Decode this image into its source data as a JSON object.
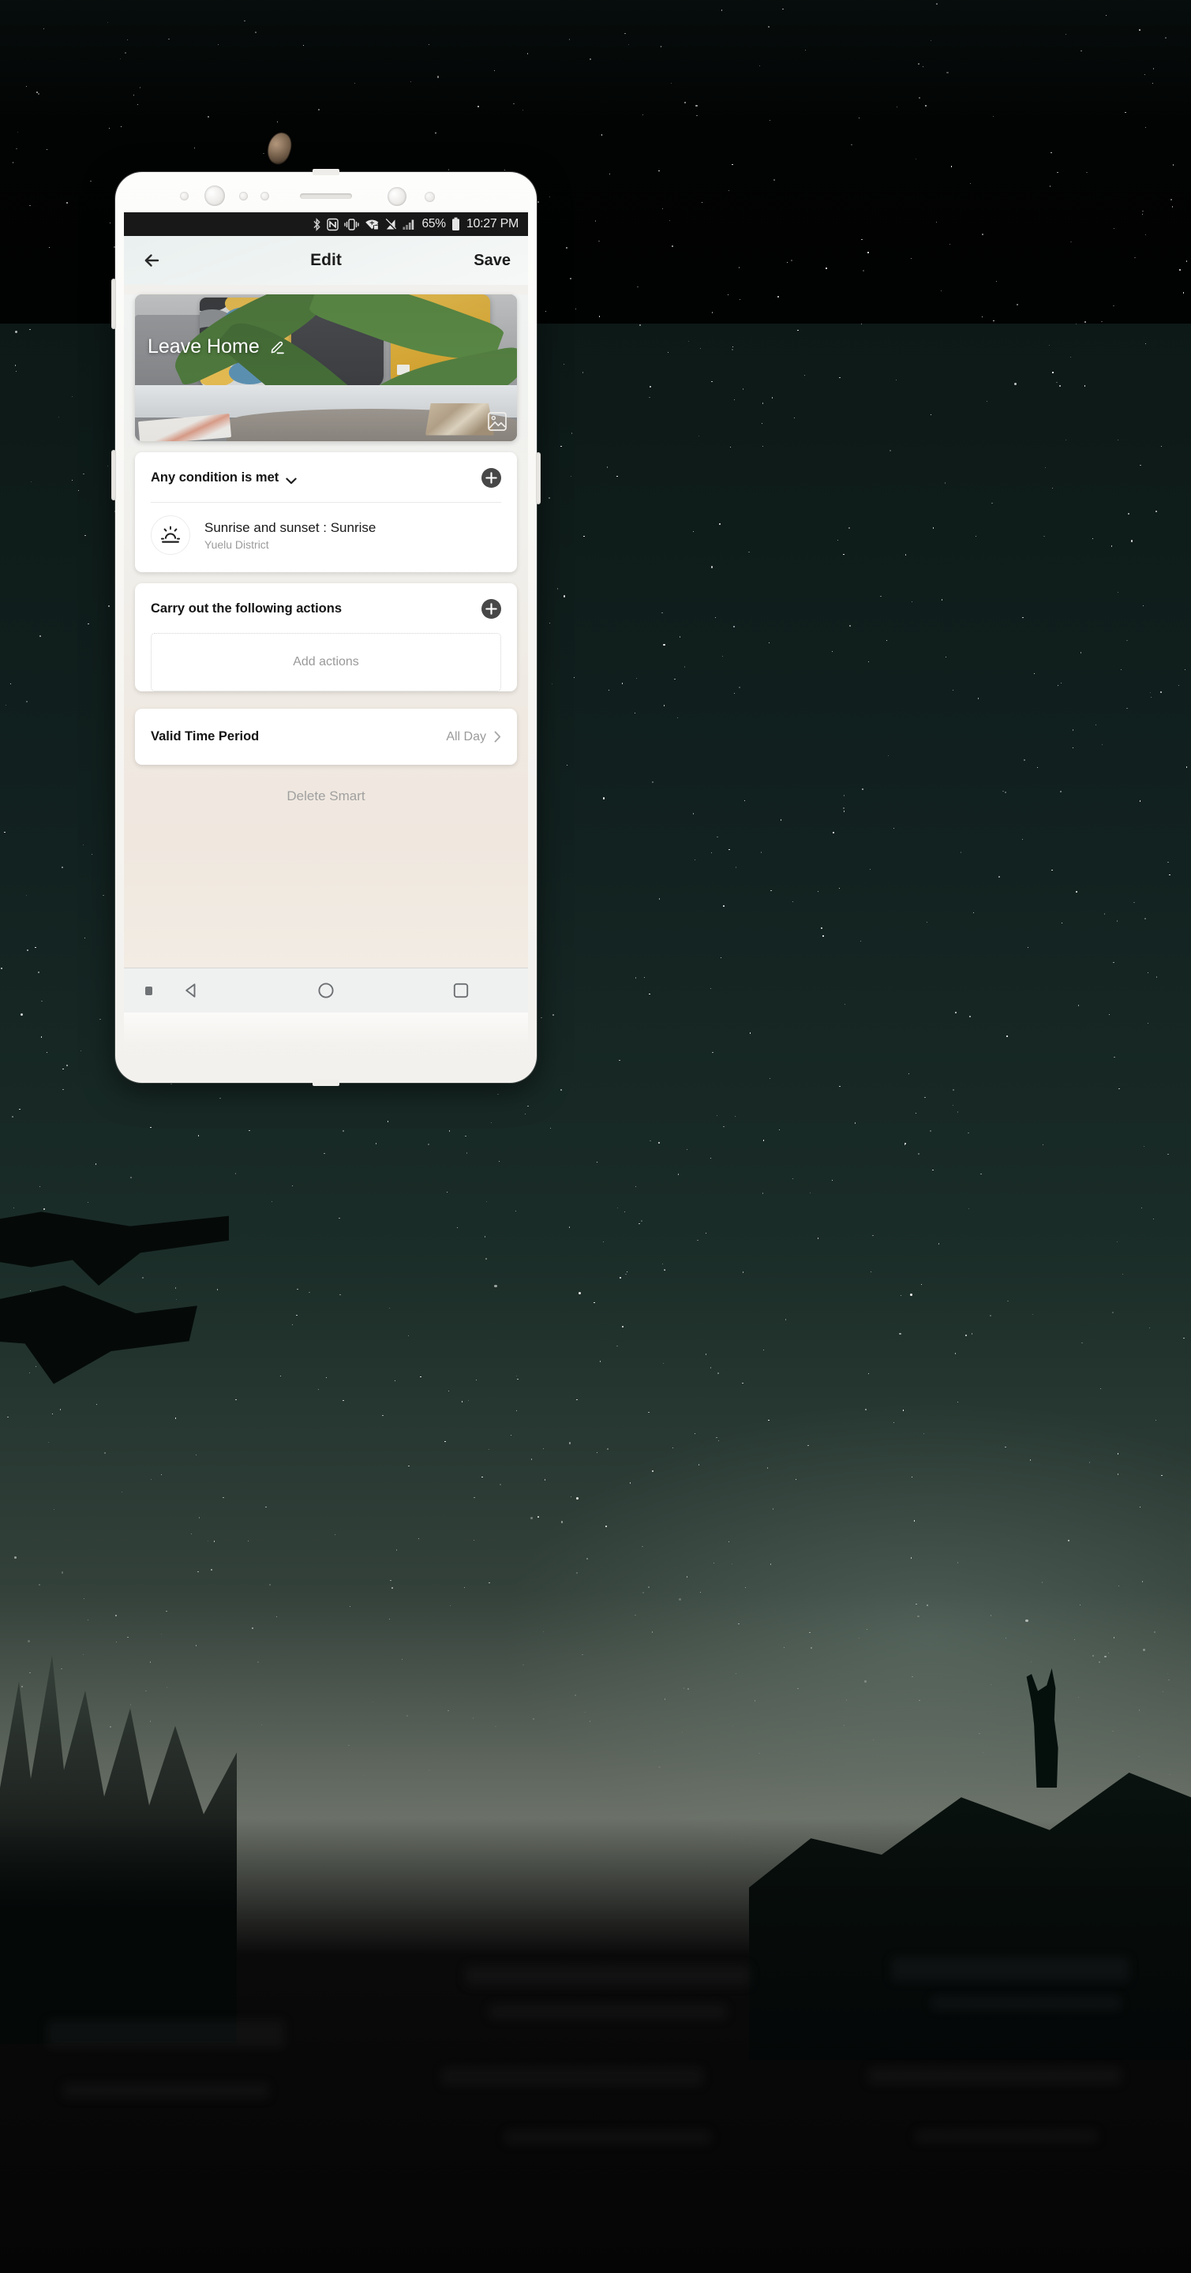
{
  "wallpaper": {
    "description": "starry night sky with tree branch and cat silhouettes"
  },
  "status_bar": {
    "icons": [
      "bluetooth-icon",
      "nfc-icon",
      "vibrate-icon",
      "wifi-secured-icon",
      "mobile-data-off-icon",
      "signal-bars-icon"
    ],
    "battery_percent": "65%",
    "battery_icon": "battery-icon",
    "clock": "10:27 PM"
  },
  "header": {
    "back_icon": "back-arrow-icon",
    "title": "Edit",
    "save_label": "Save"
  },
  "hero": {
    "scene_name": "Leave Home",
    "edit_icon": "pencil-icon",
    "image_picker_icon": "image-icon"
  },
  "conditions": {
    "title": "Any condition is met",
    "dropdown_icon": "chevron-down-icon",
    "add_icon": "plus-circle-icon",
    "items": [
      {
        "icon": "sunrise-icon",
        "title": "Sunrise and sunset : Sunrise",
        "subtitle": "Yuelu District"
      }
    ]
  },
  "actions": {
    "title": "Carry out the following actions",
    "add_icon": "plus-circle-icon",
    "empty_label": "Add actions"
  },
  "valid_time": {
    "title": "Valid Time Period",
    "value": "All Day",
    "chevron_icon": "chevron-right-icon"
  },
  "footer": {
    "delete_label": "Delete Smart"
  },
  "navbar": {
    "indicator_icon": "dot-indicator-icon",
    "back_icon": "nav-back-triangle-icon",
    "home_icon": "nav-home-circle-icon",
    "recents_icon": "nav-recents-square-icon"
  },
  "colors": {
    "status_bar_bg": "#181818",
    "card_bg": "#ffffff",
    "accent_dark": "#404040",
    "muted_text": "#9b9b9b",
    "page_bg": "#f0f0ec"
  }
}
